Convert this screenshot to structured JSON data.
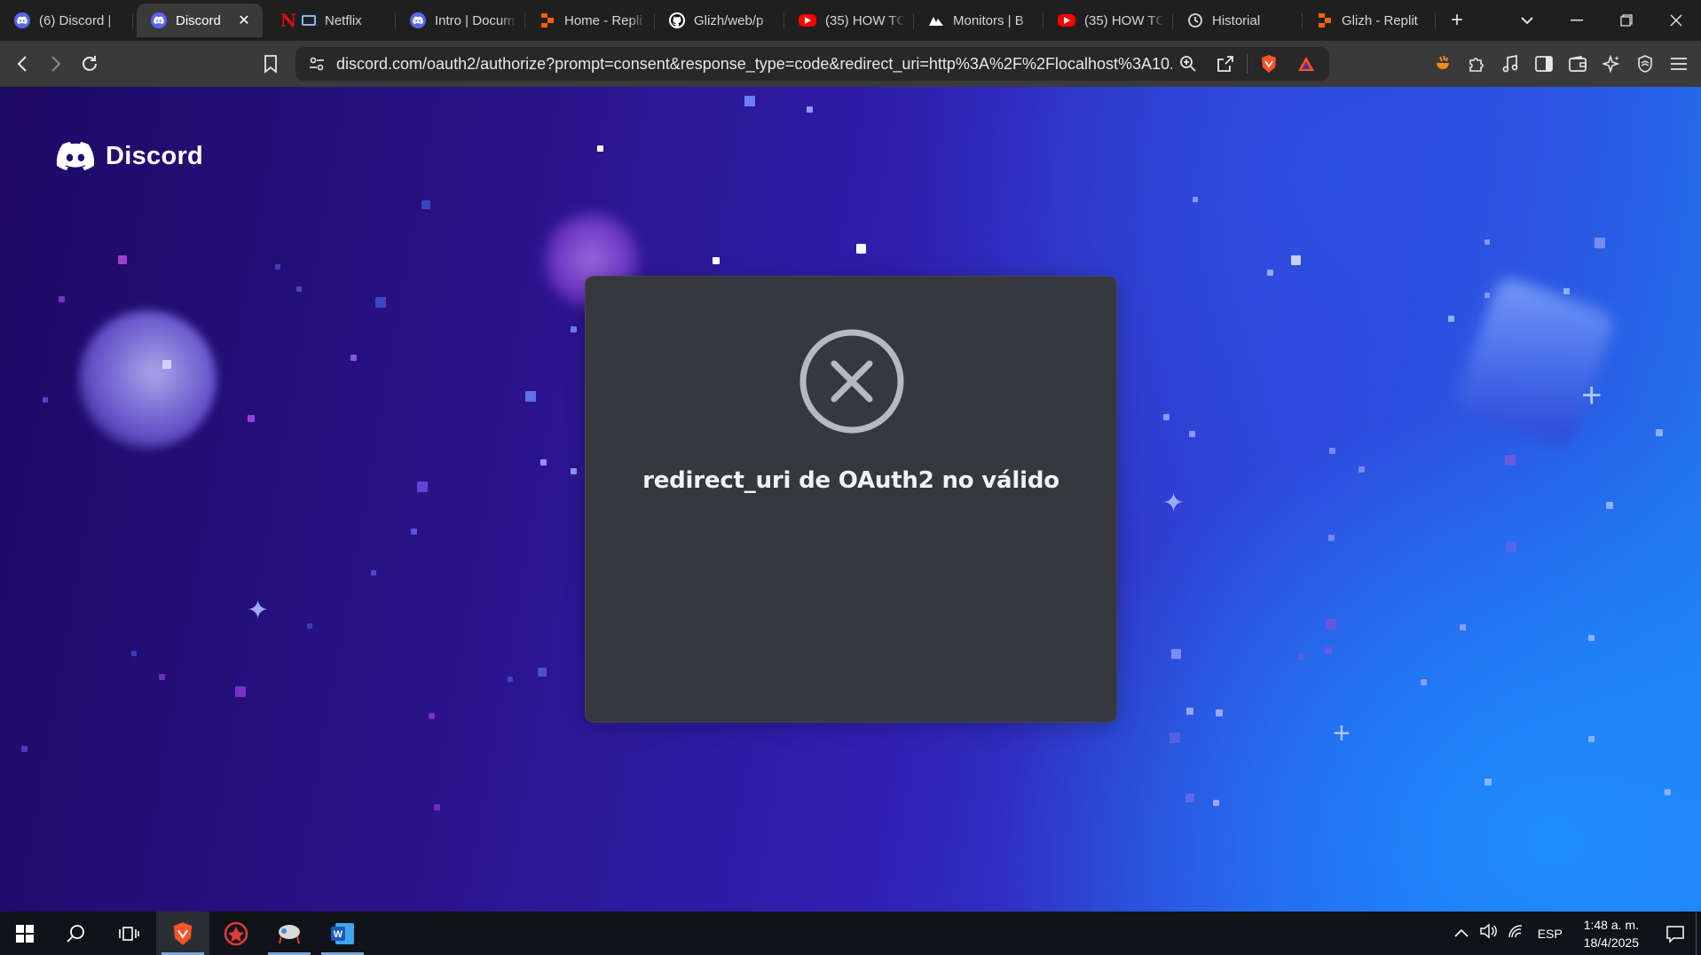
{
  "browser": {
    "tabs": [
      {
        "title": "(6) Discord |",
        "favicon": "discord-icon",
        "active": false
      },
      {
        "title": "Discord",
        "favicon": "discord-icon",
        "active": true
      },
      {
        "title": "Netflix",
        "favicon": "netflix-icon",
        "active": false
      },
      {
        "title": "Intro | Docum",
        "favicon": "discord-icon",
        "active": false
      },
      {
        "title": "Home - Repli",
        "favicon": "replit-icon",
        "active": false
      },
      {
        "title": "Glizh/web/p",
        "favicon": "github-icon",
        "active": false
      },
      {
        "title": "(35) HOW TC",
        "favicon": "youtube-icon",
        "active": false
      },
      {
        "title": "Monitors | B",
        "favicon": "monitor-icon",
        "active": false
      },
      {
        "title": "(35) HOW TC",
        "favicon": "youtube-icon",
        "active": false
      },
      {
        "title": "Historial",
        "favicon": "history-icon",
        "active": false
      },
      {
        "title": "Glizh - Replit",
        "favicon": "replit-icon",
        "active": false
      }
    ],
    "active_tab_close": "✕",
    "new_tab": "+",
    "tab_search": "⌄",
    "window_controls": {
      "minimize": "─",
      "restore": "❐",
      "close": "✕"
    },
    "address_bar": {
      "url": "discord.com/oauth2/authorize?prompt=consent&response_type=code&redirect_uri=http%3A%2F%2Flocalhost%3A10..."
    },
    "nav": {
      "back": "❮",
      "forward": "❯",
      "reload": "↻"
    }
  },
  "page": {
    "brand": "Discord",
    "error_message": "redirect_uri de OAuth2 no válido"
  },
  "taskbar": {
    "language": "ESP",
    "time": "1:48 a. m.",
    "date": "18/4/2025"
  },
  "colors": {
    "discord_blurple": "#5865f2",
    "card_bg": "#37383e",
    "error_icon": "#b5bac1",
    "brave_orange": "#fb542b"
  }
}
